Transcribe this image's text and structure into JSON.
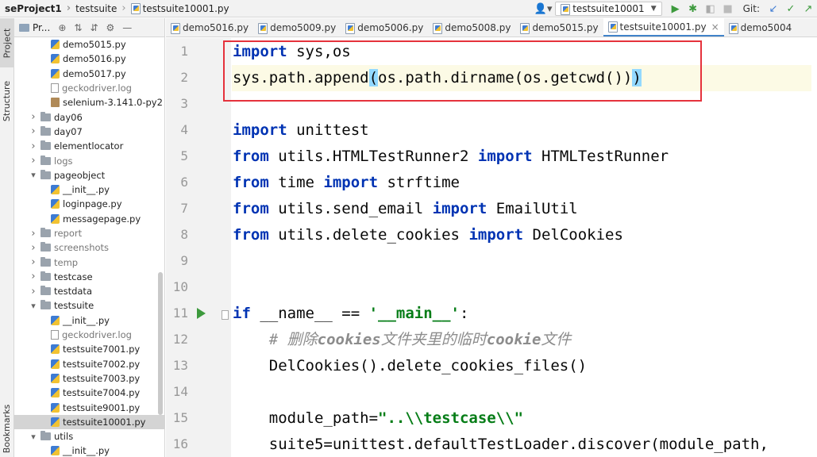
{
  "navbar": {
    "project": "seProject1",
    "folder": "testsuite",
    "file": "testsuite10001.py",
    "run_config": "testsuite10001",
    "git_label": "Git:"
  },
  "leftstrip": {
    "project_tab": "Project",
    "structure_tab": "Structure",
    "bookmarks_tab": "Bookmarks"
  },
  "project_panel": {
    "title": "Pr...",
    "items": [
      {
        "label": "demo5015.py",
        "type": "py",
        "depth": 2,
        "arrow": ""
      },
      {
        "label": "demo5016.py",
        "type": "py",
        "depth": 2,
        "arrow": ""
      },
      {
        "label": "demo5017.py",
        "type": "py",
        "depth": 2,
        "arrow": ""
      },
      {
        "label": "geckodriver.log",
        "type": "txt",
        "depth": 2,
        "arrow": "",
        "dim": true
      },
      {
        "label": "selenium-3.141.0-py2",
        "type": "jar",
        "depth": 2,
        "arrow": ""
      },
      {
        "label": "day06",
        "type": "folder",
        "depth": 1,
        "arrow": "›"
      },
      {
        "label": "day07",
        "type": "folder",
        "depth": 1,
        "arrow": "›"
      },
      {
        "label": "elementlocator",
        "type": "folder",
        "depth": 1,
        "arrow": "›"
      },
      {
        "label": "logs",
        "type": "folder",
        "depth": 1,
        "arrow": "›",
        "dim": true
      },
      {
        "label": "pageobject",
        "type": "folder",
        "depth": 1,
        "arrow": "⌄"
      },
      {
        "label": "__init__.py",
        "type": "py",
        "depth": 2,
        "arrow": ""
      },
      {
        "label": "loginpage.py",
        "type": "py",
        "depth": 2,
        "arrow": ""
      },
      {
        "label": "messagepage.py",
        "type": "py",
        "depth": 2,
        "arrow": ""
      },
      {
        "label": "report",
        "type": "folder",
        "depth": 1,
        "arrow": "›",
        "dim": true
      },
      {
        "label": "screenshots",
        "type": "folder",
        "depth": 1,
        "arrow": "›",
        "dim": true
      },
      {
        "label": "temp",
        "type": "folder",
        "depth": 1,
        "arrow": "›",
        "dim": true
      },
      {
        "label": "testcase",
        "type": "folder",
        "depth": 1,
        "arrow": "›"
      },
      {
        "label": "testdata",
        "type": "folder",
        "depth": 1,
        "arrow": "›"
      },
      {
        "label": "testsuite",
        "type": "folder",
        "depth": 1,
        "arrow": "⌄"
      },
      {
        "label": "__init__.py",
        "type": "py",
        "depth": 2,
        "arrow": ""
      },
      {
        "label": "geckodriver.log",
        "type": "txt",
        "depth": 2,
        "arrow": "",
        "dim": true
      },
      {
        "label": "testsuite7001.py",
        "type": "py",
        "depth": 2,
        "arrow": ""
      },
      {
        "label": "testsuite7002.py",
        "type": "py",
        "depth": 2,
        "arrow": ""
      },
      {
        "label": "testsuite7003.py",
        "type": "py",
        "depth": 2,
        "arrow": ""
      },
      {
        "label": "testsuite7004.py",
        "type": "py",
        "depth": 2,
        "arrow": ""
      },
      {
        "label": "testsuite9001.py",
        "type": "py",
        "depth": 2,
        "arrow": ""
      },
      {
        "label": "testsuite10001.py",
        "type": "py",
        "depth": 2,
        "arrow": "",
        "selected": true
      },
      {
        "label": "utils",
        "type": "folder",
        "depth": 1,
        "arrow": "⌄"
      },
      {
        "label": "__init__.py",
        "type": "py",
        "depth": 2,
        "arrow": ""
      }
    ]
  },
  "tabs": [
    {
      "label": "demo5016.py",
      "active": false
    },
    {
      "label": "demo5009.py",
      "active": false
    },
    {
      "label": "demo5006.py",
      "active": false
    },
    {
      "label": "demo5008.py",
      "active": false
    },
    {
      "label": "demo5015.py",
      "active": false
    },
    {
      "label": "testsuite10001.py",
      "active": true
    },
    {
      "label": "demo5004",
      "active": false
    }
  ],
  "code_lines": [
    {
      "n": "1",
      "tokens": [
        [
          "kw",
          "import"
        ],
        [
          "t",
          " sys,os"
        ]
      ]
    },
    {
      "n": "2",
      "current": true,
      "tokens": [
        [
          "t",
          "sys.path.append"
        ],
        [
          "br",
          "("
        ],
        [
          "t",
          "os.path.dirname(os.getcwd())"
        ],
        [
          "br",
          ")"
        ]
      ]
    },
    {
      "n": "3",
      "tokens": []
    },
    {
      "n": "4",
      "tokens": [
        [
          "kw",
          "import"
        ],
        [
          "t",
          " unittest"
        ]
      ]
    },
    {
      "n": "5",
      "tokens": [
        [
          "kw",
          "from"
        ],
        [
          "t",
          " utils.HTMLTestRunner2 "
        ],
        [
          "kw",
          "import"
        ],
        [
          "t",
          " HTMLTestRunner"
        ]
      ]
    },
    {
      "n": "6",
      "tokens": [
        [
          "kw",
          "from"
        ],
        [
          "t",
          " time "
        ],
        [
          "kw",
          "import"
        ],
        [
          "t",
          " strftime"
        ]
      ]
    },
    {
      "n": "7",
      "tokens": [
        [
          "kw",
          "from"
        ],
        [
          "t",
          " utils.send_email "
        ],
        [
          "kw",
          "import"
        ],
        [
          "t",
          " EmailUtil"
        ]
      ]
    },
    {
      "n": "8",
      "tokens": [
        [
          "kw",
          "from"
        ],
        [
          "t",
          " utils.delete_cookies "
        ],
        [
          "kw",
          "import"
        ],
        [
          "t",
          " DelCookies"
        ]
      ]
    },
    {
      "n": "9",
      "tokens": []
    },
    {
      "n": "10",
      "tokens": []
    },
    {
      "n": "11",
      "run": true,
      "fold": true,
      "tokens": [
        [
          "kw",
          "if"
        ],
        [
          "t",
          " __name__ == "
        ],
        [
          "str",
          "'__main__'"
        ],
        [
          "t",
          ":"
        ]
      ]
    },
    {
      "n": "12",
      "tokens": [
        [
          "t",
          "    "
        ],
        [
          "cm",
          "# 删除"
        ],
        [
          "cmb",
          "cookies"
        ],
        [
          "cm",
          "文件夹里的临时"
        ],
        [
          "cmb",
          "cookie"
        ],
        [
          "cm",
          "文件"
        ]
      ]
    },
    {
      "n": "13",
      "tokens": [
        [
          "t",
          "    DelCookies().delete_cookies_files()"
        ]
      ]
    },
    {
      "n": "14",
      "tokens": []
    },
    {
      "n": "15",
      "tokens": [
        [
          "t",
          "    module_path="
        ],
        [
          "str",
          "\"..\\\\testcase\\\\\""
        ]
      ]
    },
    {
      "n": "16",
      "tokens": [
        [
          "t",
          "    suite5=unittest.defaultTestLoader.discover(module_path,"
        ]
      ]
    }
  ]
}
